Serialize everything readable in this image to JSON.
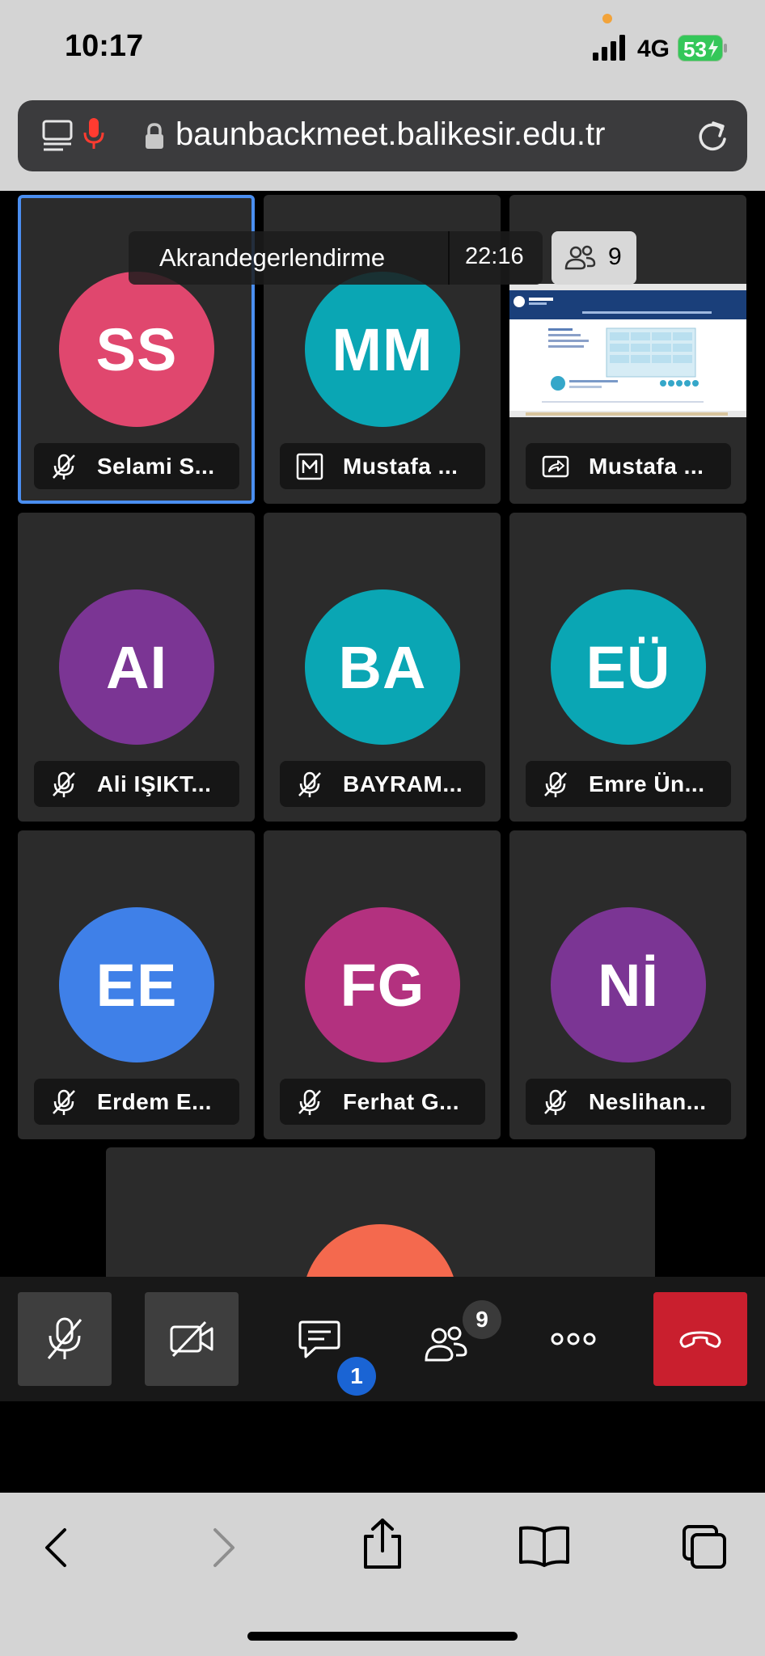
{
  "status_bar": {
    "time": "10:17",
    "network": "4G",
    "battery_percent": "53"
  },
  "browser": {
    "url": "baunbackmeet.balikesir.edu.tr",
    "icons": [
      "reader-icon",
      "microphone-recording-icon",
      "lock-icon",
      "reload-icon"
    ]
  },
  "meeting": {
    "title": "Akrandegerlendirme",
    "elapsed_time": "22:16",
    "participant_count": "9"
  },
  "participants": [
    {
      "initials": "SS",
      "name": "Selami S...",
      "color": "#e0476e",
      "status_icon": "mic-muted-icon",
      "active": true
    },
    {
      "initials": "MM",
      "name": "Mustafa ...",
      "color": "#0aa6b4",
      "status_icon": "moderator-m-icon"
    },
    {
      "initials": "",
      "name": "Mustafa ...",
      "color": "",
      "status_icon": "screen-share-icon",
      "screen_share": true
    },
    {
      "initials": "AI",
      "name": "Ali IŞIKT...",
      "color": "#7b3594",
      "status_icon": "mic-muted-icon"
    },
    {
      "initials": "BA",
      "name": "BAYRAM...",
      "color": "#0aa6b4",
      "status_icon": "mic-muted-icon"
    },
    {
      "initials": "EÜ",
      "name": "Emre Ün...",
      "color": "#0aa6b4",
      "status_icon": "mic-muted-icon"
    },
    {
      "initials": "EE",
      "name": "Erdem E...",
      "color": "#3f80e8",
      "status_icon": "mic-muted-icon"
    },
    {
      "initials": "FG",
      "name": "Ferhat G...",
      "color": "#b3317f",
      "status_icon": "mic-muted-icon"
    },
    {
      "initials": "Nİ",
      "name": "Neslihan...",
      "color": "#7b3594",
      "status_icon": "mic-muted-icon"
    }
  ],
  "partial_tile": {
    "color": "#f4694e"
  },
  "toolbar": {
    "chat_unread": "1",
    "people_count": "9",
    "buttons": [
      "mic-muted-icon",
      "camera-off-icon",
      "chat-icon",
      "participants-icon",
      "more-icon",
      "leave-call-icon"
    ],
    "leave_color": "#c91f2e"
  },
  "safari_toolbar": {
    "buttons": [
      "back-icon",
      "forward-icon",
      "share-icon",
      "bookmarks-icon",
      "tabs-icon"
    ]
  }
}
